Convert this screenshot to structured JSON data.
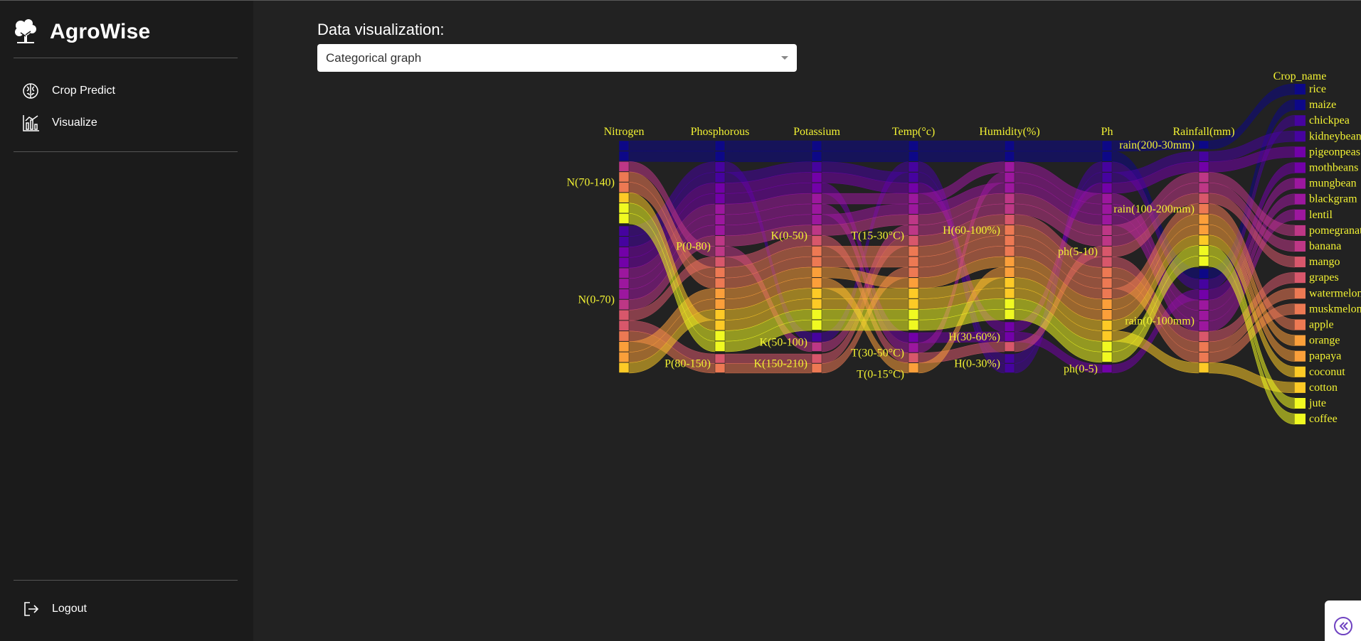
{
  "app": {
    "name": "AgroWise"
  },
  "sidebar": {
    "items": [
      {
        "label": "Crop Predict",
        "icon": "brain-icon"
      },
      {
        "label": "Visualize",
        "icon": "bar-chart-icon"
      }
    ],
    "logout_label": "Logout"
  },
  "main": {
    "select_label": "Data visualization:",
    "select_value": "Categorical graph"
  },
  "colors": {
    "sidebar_bg": "#1b1b1b",
    "main_bg": "#222222",
    "label_yellow": "#f2f233",
    "colorscale": [
      "#0d0887",
      "#46039f",
      "#7201a8",
      "#9c179e",
      "#bd3786",
      "#d8576b",
      "#ed7953",
      "#fb9f3a",
      "#fdca26",
      "#f0f921"
    ]
  },
  "chart_data": {
    "type": "parallel_categories",
    "dimensions": [
      {
        "name": "Nitrogen",
        "categories": [
          "N(70-140)",
          "N(0-70)"
        ]
      },
      {
        "name": "Phosphorous",
        "categories": [
          "P(0-80)",
          "P(80-150)"
        ]
      },
      {
        "name": "Potassium",
        "categories": [
          "K(0-50)",
          "K(50-100)",
          "K(150-210)"
        ]
      },
      {
        "name": "Temp(°c)",
        "categories": [
          "T(15-30°C)",
          "T(30-50°C)",
          "T(0-15°C)"
        ]
      },
      {
        "name": "Humidity(%)",
        "categories": [
          "H(60-100%)",
          "H(30-60%)",
          "H(0-30%)"
        ]
      },
      {
        "name": "Ph",
        "categories": [
          "ph(5-10)",
          "ph(0-5)"
        ]
      },
      {
        "name": "Rainfall(mm)",
        "categories": [
          "rain(200-30mm)",
          "rain(100-200mm)",
          "rain(0-100mm)"
        ]
      },
      {
        "name": "Crop_name",
        "categories": [
          "rice",
          "maize",
          "chickpea",
          "kidneybeans",
          "pigeonpeas",
          "mothbeans",
          "mungbean",
          "blackgram",
          "lentil",
          "pomegranate",
          "banana",
          "mango",
          "grapes",
          "watermelon",
          "muskmelon",
          "apple",
          "orange",
          "papaya",
          "coconut",
          "cotton",
          "jute",
          "coffee"
        ]
      }
    ],
    "crop_paths": [
      [
        "N(70-140)",
        "P(0-80)",
        "K(0-50)",
        "T(15-30°C)",
        "H(60-100%)",
        "ph(5-10)",
        "rain(200-30mm)",
        "rice"
      ],
      [
        "N(70-140)",
        "P(0-80)",
        "K(0-50)",
        "T(15-30°C)",
        "H(60-100%)",
        "ph(5-10)",
        "rain(0-100mm)",
        "maize"
      ],
      [
        "N(0-70)",
        "P(0-80)",
        "K(50-100)",
        "T(15-30°C)",
        "H(0-30%)",
        "ph(5-10)",
        "rain(0-100mm)",
        "chickpea"
      ],
      [
        "N(0-70)",
        "P(0-80)",
        "K(0-50)",
        "T(15-30°C)",
        "H(0-30%)",
        "ph(5-10)",
        "rain(100-200mm)",
        "kidneybeans"
      ],
      [
        "N(0-70)",
        "P(0-80)",
        "K(0-50)",
        "T(15-30°C)",
        "H(30-60%)",
        "ph(5-10)",
        "rain(100-200mm)",
        "pigeonpeas"
      ],
      [
        "N(0-70)",
        "P(0-80)",
        "K(0-50)",
        "T(30-50°C)",
        "H(30-60%)",
        "ph(0-5)",
        "rain(0-100mm)",
        "mothbeans"
      ],
      [
        "N(0-70)",
        "P(0-80)",
        "K(0-50)",
        "T(15-30°C)",
        "H(60-100%)",
        "ph(5-10)",
        "rain(0-100mm)",
        "mungbean"
      ],
      [
        "N(0-70)",
        "P(0-80)",
        "K(0-50)",
        "T(30-50°C)",
        "H(60-100%)",
        "ph(5-10)",
        "rain(0-100mm)",
        "blackgram"
      ],
      [
        "N(0-70)",
        "P(0-80)",
        "K(0-50)",
        "T(15-30°C)",
        "H(60-100%)",
        "ph(5-10)",
        "rain(0-100mm)",
        "lentil"
      ],
      [
        "N(0-70)",
        "P(0-80)",
        "K(0-50)",
        "T(15-30°C)",
        "H(60-100%)",
        "ph(5-10)",
        "rain(100-200mm)",
        "pomegranate"
      ],
      [
        "N(70-140)",
        "P(0-80)",
        "K(50-100)",
        "T(15-30°C)",
        "H(60-100%)",
        "ph(5-10)",
        "rain(100-200mm)",
        "banana"
      ],
      [
        "N(0-70)",
        "P(0-80)",
        "K(0-50)",
        "T(30-50°C)",
        "H(30-60%)",
        "ph(5-10)",
        "rain(100-200mm)",
        "mango"
      ],
      [
        "N(0-70)",
        "P(80-150)",
        "K(150-210)",
        "T(15-30°C)",
        "H(60-100%)",
        "ph(5-10)",
        "rain(0-100mm)",
        "grapes"
      ],
      [
        "N(70-140)",
        "P(0-80)",
        "K(0-50)",
        "T(15-30°C)",
        "H(60-100%)",
        "ph(5-10)",
        "rain(0-100mm)",
        "watermelon"
      ],
      [
        "N(70-140)",
        "P(0-80)",
        "K(0-50)",
        "T(15-30°C)",
        "H(60-100%)",
        "ph(5-10)",
        "rain(0-100mm)",
        "muskmelon"
      ],
      [
        "N(0-70)",
        "P(80-150)",
        "K(150-210)",
        "T(15-30°C)",
        "H(60-100%)",
        "ph(5-10)",
        "rain(100-200mm)",
        "apple"
      ],
      [
        "N(0-70)",
        "P(0-80)",
        "K(0-50)",
        "T(15-30°C)",
        "H(60-100%)",
        "ph(5-10)",
        "rain(100-200mm)",
        "orange"
      ],
      [
        "N(0-70)",
        "P(0-80)",
        "K(0-50)",
        "T(30-50°C)",
        "H(60-100%)",
        "ph(5-10)",
        "rain(100-200mm)",
        "papaya"
      ],
      [
        "N(0-70)",
        "P(0-80)",
        "K(0-50)",
        "T(15-30°C)",
        "H(60-100%)",
        "ph(5-10)",
        "rain(100-200mm)",
        "coconut"
      ],
      [
        "N(70-140)",
        "P(0-80)",
        "K(0-50)",
        "T(15-30°C)",
        "H(60-100%)",
        "ph(5-10)",
        "rain(0-100mm)",
        "cotton"
      ],
      [
        "N(70-140)",
        "P(0-80)",
        "K(0-50)",
        "T(15-30°C)",
        "H(60-100%)",
        "ph(5-10)",
        "rain(100-200mm)",
        "jute"
      ],
      [
        "N(70-140)",
        "P(0-80)",
        "K(0-50)",
        "T(15-30°C)",
        "H(60-100%)",
        "ph(5-10)",
        "rain(100-200mm)",
        "coffee"
      ]
    ]
  }
}
